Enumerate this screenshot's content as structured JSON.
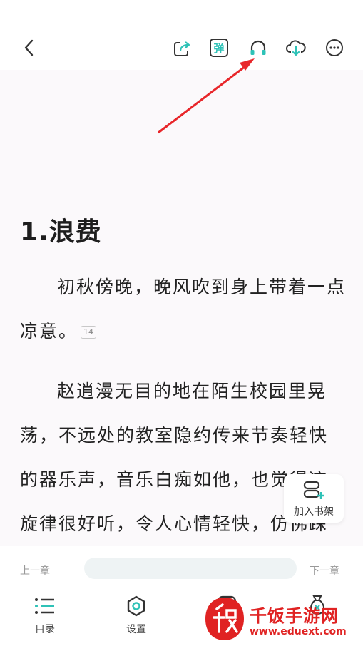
{
  "toolbar": {
    "back_icon": "chevron-left-icon",
    "share_icon": "share-icon",
    "danmaku_label": "弹",
    "listen_icon": "headphones-icon",
    "download_icon": "cloud-download-icon",
    "more_icon": "more-icon",
    "accent_color": "#2ec2b7"
  },
  "content": {
    "chapter_title": "1.浪费",
    "paragraphs": [
      {
        "text": "初秋傍晚，晚风吹到身上带着一点凉意。",
        "comment_count": "14"
      },
      {
        "text": "赵逍漫无目的地在陌生校园里晃荡，不远处的教室隐约传来节奏轻快的器乐声，音乐白痴如他，也觉得这旋律很好听，令人心情轻快，仿佛踩在"
      }
    ]
  },
  "add_to_shelf": {
    "label": "加入书架",
    "icon": "bookshelf-add-icon"
  },
  "progress": {
    "prev_label": "上一章",
    "next_label": "下一章"
  },
  "tabbar": {
    "items": [
      {
        "label": "目录",
        "icon": "list-icon"
      },
      {
        "label": "设置",
        "icon": "settings-icon"
      },
      {
        "label": "",
        "icon": "moon-icon"
      },
      {
        "label": "",
        "icon": "money-bag-icon"
      }
    ]
  },
  "watermark": {
    "text": "千饭手游网",
    "url": "www.eduext.com"
  }
}
